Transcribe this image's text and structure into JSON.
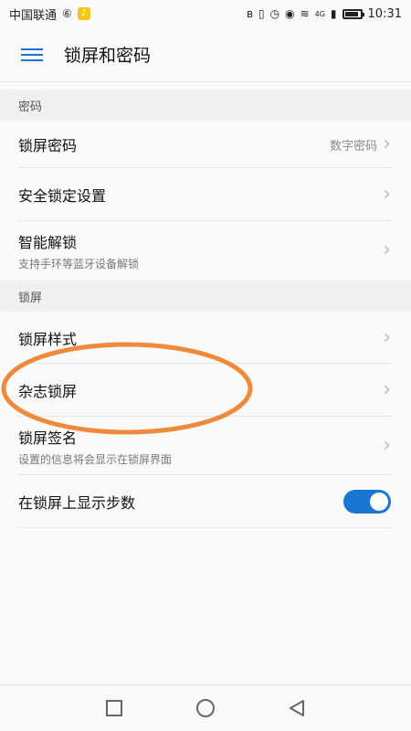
{
  "status_bar": {
    "carrier": "中国联通",
    "network": "4G",
    "time": "10:31",
    "battery_level": 0.9
  },
  "app_bar": {
    "title": "锁屏和密码",
    "menu_icon": "menu-icon"
  },
  "sections": [
    {
      "header": "密码",
      "items": [
        {
          "title": "锁屏密码",
          "value": "数字密码"
        },
        {
          "title": "安全锁定设置"
        },
        {
          "title": "智能解锁",
          "subtitle": "支持手环等蓝牙设备解锁"
        }
      ]
    },
    {
      "header": "锁屏",
      "items": [
        {
          "title": "锁屏样式"
        },
        {
          "title": "杂志锁屏"
        },
        {
          "title": "锁屏签名",
          "subtitle": "设置的信息将会显示在锁屏界面"
        },
        {
          "title": "在锁屏上显示步数",
          "toggle_on": true
        }
      ]
    }
  ],
  "annotation": {
    "color": "#ef8a3c"
  },
  "colors": {
    "accent": "#1976d2"
  }
}
